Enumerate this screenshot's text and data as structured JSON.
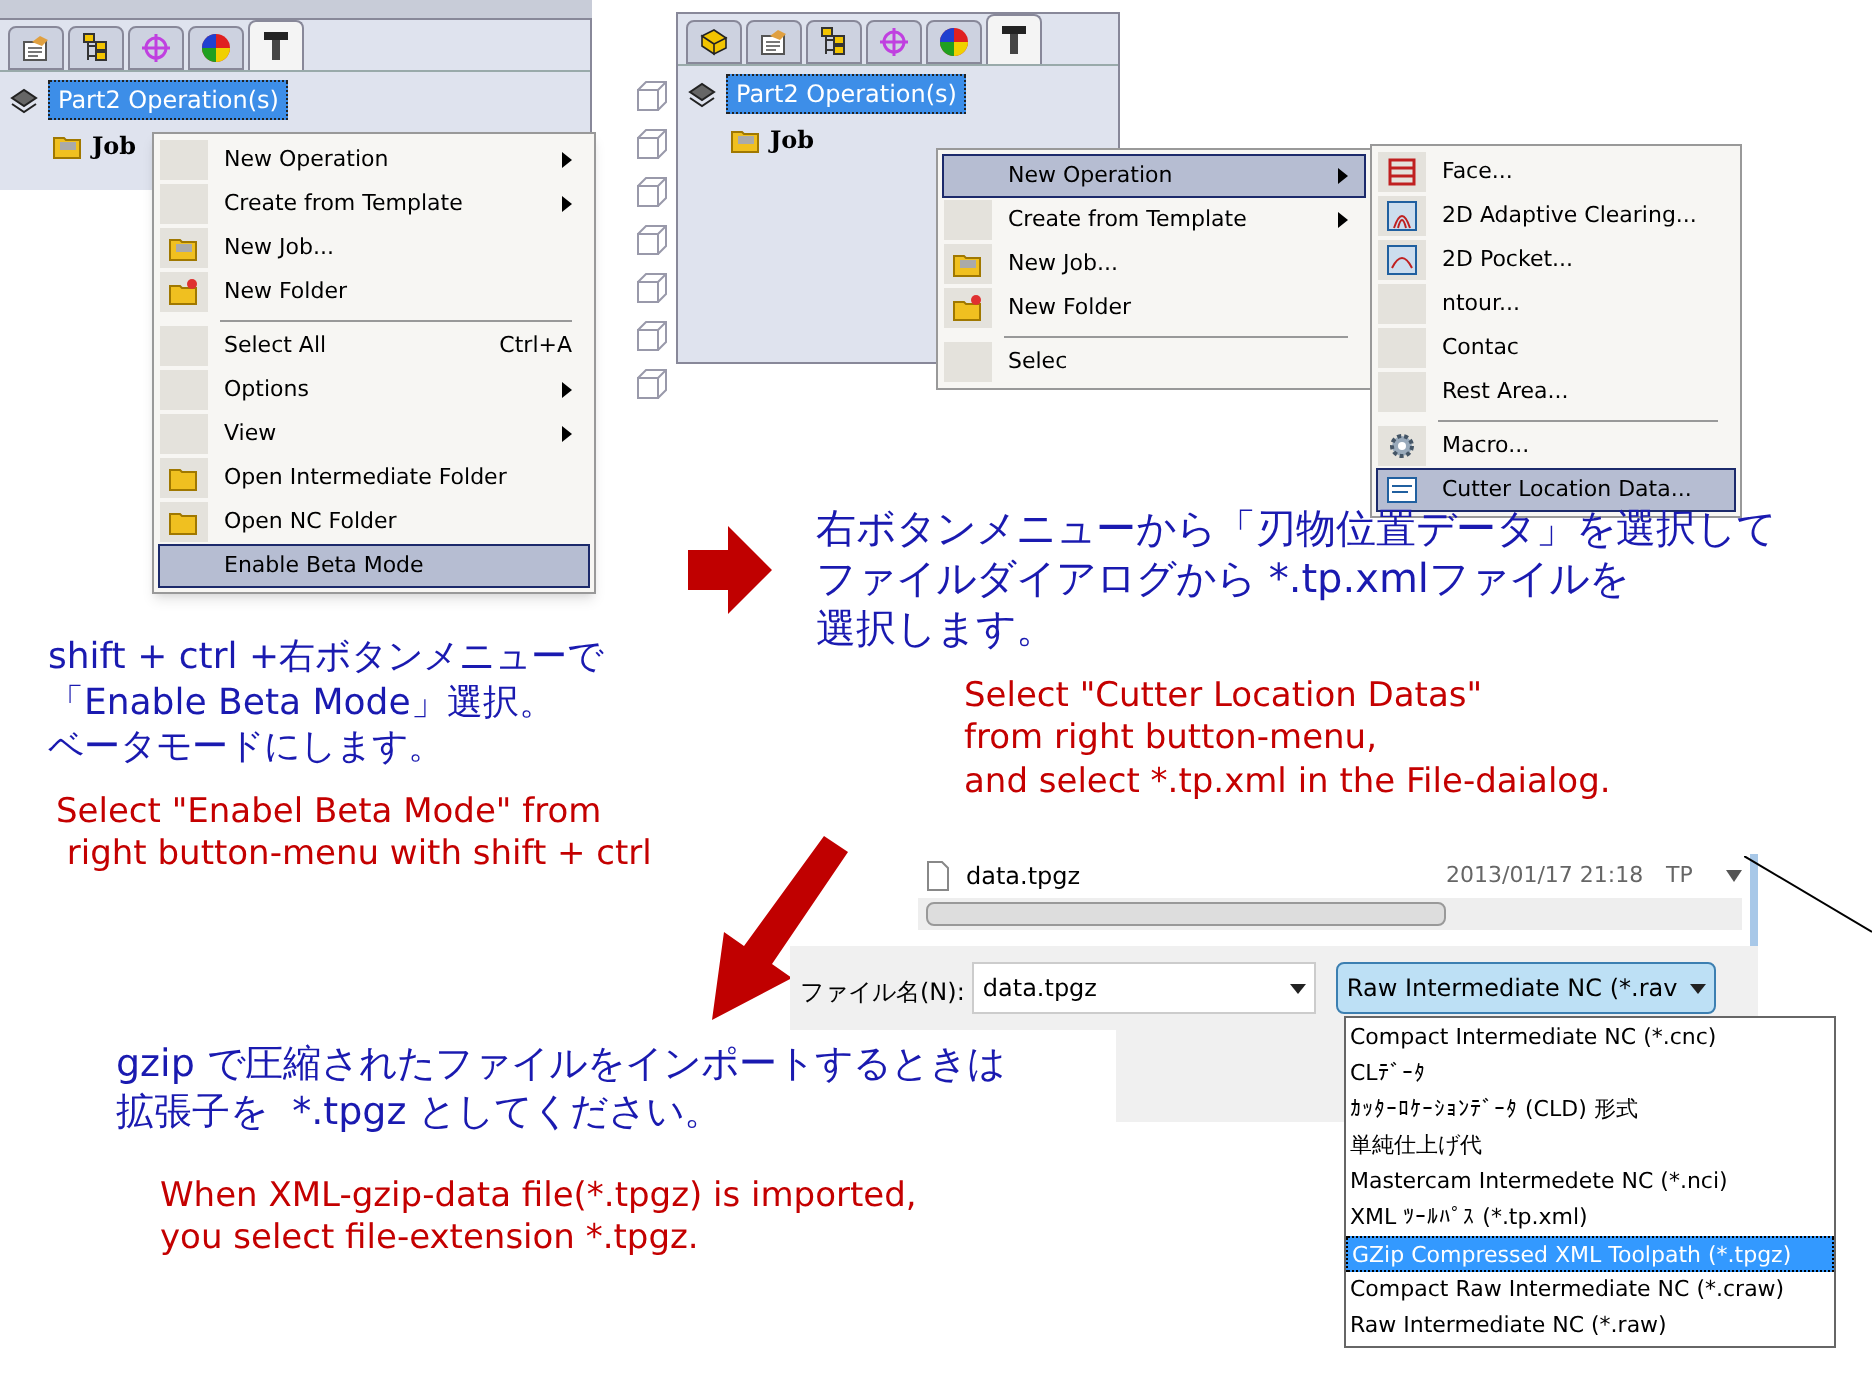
{
  "left_panel": {
    "tabs": [
      {
        "kind": "properties",
        "selected": false
      },
      {
        "kind": "tree",
        "selected": false
      },
      {
        "kind": "crosshair",
        "selected": false
      },
      {
        "kind": "colorwheel",
        "selected": false
      },
      {
        "kind": "tool",
        "selected": true
      }
    ],
    "tree_root": "Part2 Operation(s)",
    "tree_child": "Job",
    "menu": [
      {
        "label": "New Operation",
        "kind": "plain",
        "submenu": true,
        "separator_before": false,
        "selected": false
      },
      {
        "label": "Create from Template",
        "kind": "plain",
        "submenu": true,
        "separator_before": false,
        "selected": false
      },
      {
        "label": "New Job...",
        "kind": "job",
        "submenu": false,
        "separator_before": false,
        "selected": false
      },
      {
        "label": "New Folder",
        "kind": "newfolder",
        "submenu": false,
        "separator_before": false,
        "selected": false
      },
      {
        "label": "Select All",
        "shortcut": "Ctrl+A",
        "kind": "plain",
        "submenu": false,
        "separator_before": true,
        "selected": false
      },
      {
        "label": "Options",
        "kind": "plain",
        "submenu": true,
        "separator_before": false,
        "selected": false
      },
      {
        "label": "View",
        "kind": "plain",
        "submenu": true,
        "separator_before": false,
        "selected": false
      },
      {
        "label": "Open Intermediate Folder",
        "kind": "folder",
        "submenu": false,
        "separator_before": false,
        "selected": false
      },
      {
        "label": "Open NC Folder",
        "kind": "folder",
        "submenu": false,
        "separator_before": false,
        "selected": false
      },
      {
        "label": "Enable Beta Mode",
        "kind": "plain",
        "submenu": false,
        "separator_before": false,
        "selected": true
      }
    ]
  },
  "right_panel": {
    "tabs": [
      {
        "kind": "part",
        "selected": false
      },
      {
        "kind": "properties",
        "selected": false
      },
      {
        "kind": "tree",
        "selected": false
      },
      {
        "kind": "crosshair",
        "selected": false
      },
      {
        "kind": "colorwheel",
        "selected": false
      },
      {
        "kind": "tool",
        "selected": true
      }
    ],
    "tree_root": "Part2 Operation(s)",
    "tree_child": "Job",
    "menu": [
      {
        "label": "New Operation",
        "kind": "plain",
        "submenu": true,
        "separator_before": false,
        "selected": true
      },
      {
        "label": "Create from Template",
        "kind": "plain",
        "submenu": true,
        "separator_before": false,
        "selected": false
      },
      {
        "label": "New Job...",
        "kind": "job",
        "submenu": false,
        "separator_before": false,
        "selected": false
      },
      {
        "label": "New Folder",
        "kind": "newfolder",
        "submenu": false,
        "separator_before": false,
        "selected": false
      },
      {
        "label": "Selec",
        "kind": "plain",
        "submenu": false,
        "separator_before": true,
        "selected": false
      }
    ],
    "submenu": [
      {
        "label": "Face...",
        "kind": "face",
        "separator_before": false,
        "selected": false
      },
      {
        "label": "2D Adaptive Clearing...",
        "kind": "adaptive",
        "separator_before": false,
        "selected": false
      },
      {
        "label": "2D Pocket...",
        "kind": "pocket",
        "separator_before": false,
        "selected": false
      },
      {
        "label": "ntour...",
        "kind": "plain",
        "separator_before": false,
        "selected": false
      },
      {
        "label": "Contac",
        "kind": "plain",
        "separator_before": false,
        "selected": false
      },
      {
        "label": "Rest Area...",
        "kind": "plain",
        "separator_before": false,
        "selected": false
      },
      {
        "label": "Macro...",
        "kind": "macro",
        "separator_before": true,
        "selected": false
      },
      {
        "label": "Cutter Location Data...",
        "kind": "cld",
        "separator_before": false,
        "selected": true
      }
    ]
  },
  "notes": [
    {
      "kind": "ja",
      "lines": [
        "右ボタンメニューから「刃物位置データ」を選択して",
        "ファイルダイアログから *.tp.xmlファイルを",
        "選択します。"
      ]
    },
    {
      "kind": "en",
      "lines": [
        "Select \"Cutter Location Datas\"",
        "from right button-menu,",
        "and select *.tp.xml in the File-daialog."
      ]
    },
    {
      "kind": "ja",
      "lines": [
        "shift + ctrl +右ボタンメニューで",
        "「Enable Beta Mode」選択。",
        "ベータモードにします。"
      ]
    },
    {
      "kind": "en",
      "lines": [
        "Select \"Enabel Beta Mode\" from",
        " right button-menu with shift + ctrl"
      ]
    },
    {
      "kind": "ja",
      "lines": [
        "gzip で圧縮されたファイルをインポートするときは",
        "拡張子を  *.tpgz としてください。"
      ]
    },
    {
      "kind": "en",
      "lines": [
        "When XML-gzip-data file(*.tpgz) is imported,",
        "you select file-extension *.tpgz."
      ]
    }
  ],
  "file_dialog": {
    "file": {
      "name": "data.tpgz",
      "date": "2013/01/17 21:18",
      "type": "TP"
    },
    "filename_label": "ファイル名(N):",
    "filename_value": "data.tpgz",
    "filetype_value": "Raw Intermediate NC (*.rav",
    "filetype_options": [
      {
        "label": "Compact Intermediate NC (*.cnc)",
        "selected": false
      },
      {
        "label": "CLﾃﾞｰﾀ",
        "selected": false
      },
      {
        "label": "ｶｯﾀｰﾛｹｰｼｮﾝﾃﾞｰﾀ (CLD) 形式",
        "selected": false
      },
      {
        "label": "単純仕上げ代",
        "selected": false
      },
      {
        "label": "Mastercam Intermedete NC (*.nci)",
        "selected": false
      },
      {
        "label": "XML ﾂｰﾙﾊﾟｽ (*.tp.xml)",
        "selected": false
      },
      {
        "label": "GZip Compressed XML Toolpath (*.tpgz)",
        "selected": true
      },
      {
        "label": "Compact Raw Intermediate NC (*.craw)",
        "selected": false
      },
      {
        "label": "Raw Intermediate NC (*.raw)",
        "selected": false
      }
    ]
  }
}
